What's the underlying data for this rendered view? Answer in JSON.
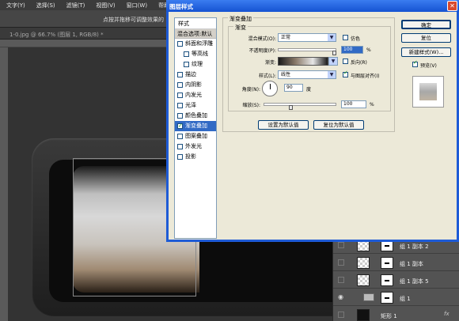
{
  "menubar": {
    "items": [
      "文字(Y)",
      "选择(S)",
      "滤镜(T)",
      "视图(V)",
      "窗口(W)",
      "帮助"
    ]
  },
  "options_bar": {
    "hint": "点按并拖移可调整效果的"
  },
  "document_tab": {
    "label": "1-0.jpg @ 66.7% (图层 1, RGB/8) *"
  },
  "dialog": {
    "title": "图层样式",
    "styles_header": "样式",
    "blend_options": "混合选项:默认",
    "styles": [
      {
        "label": "斜面和浮雕",
        "checked": false,
        "sub": false
      },
      {
        "label": "等高线",
        "checked": false,
        "sub": true
      },
      {
        "label": "纹理",
        "checked": false,
        "sub": true
      },
      {
        "label": "描边",
        "checked": false,
        "sub": false
      },
      {
        "label": "内阴影",
        "checked": false,
        "sub": false
      },
      {
        "label": "内发光",
        "checked": false,
        "sub": false
      },
      {
        "label": "光泽",
        "checked": false,
        "sub": false
      },
      {
        "label": "颜色叠加",
        "checked": false,
        "sub": false
      },
      {
        "label": "渐变叠加",
        "checked": true,
        "sub": false,
        "active": true
      },
      {
        "label": "图案叠加",
        "checked": false,
        "sub": false
      },
      {
        "label": "外发光",
        "checked": false,
        "sub": false
      },
      {
        "label": "投影",
        "checked": false,
        "sub": false
      }
    ],
    "panel_title": "渐变叠加",
    "sub_title": "渐变",
    "blend_mode_label": "混合模式(O):",
    "blend_mode_value": "正常",
    "dither_label": "仿色",
    "opacity_label": "不透明度(P):",
    "opacity_value": "100",
    "percent": "%",
    "gradient_label": "渐变:",
    "reverse_label": "反向(R)",
    "style_label": "样式(L):",
    "style_value": "线性",
    "align_label": "与图层对齐(I)",
    "angle_label": "角度(N):",
    "angle_value": "90",
    "degree": "度",
    "scale_label": "缩放(S):",
    "scale_value": "100",
    "set_default": "设置为默认值",
    "reset_default": "复位为默认值",
    "ok": "确定",
    "reset": "复位",
    "new_style": "新建样式(W)...",
    "preview_label": "预览(V)"
  },
  "layers": [
    {
      "name": "组 1 副本 2",
      "type": "layer"
    },
    {
      "name": "组 1 副本",
      "type": "layer"
    },
    {
      "name": "组 1 副本 5",
      "type": "layer"
    },
    {
      "name": "组 1",
      "type": "group"
    },
    {
      "name": "矩形 1",
      "type": "shape",
      "fx": "fx"
    }
  ]
}
